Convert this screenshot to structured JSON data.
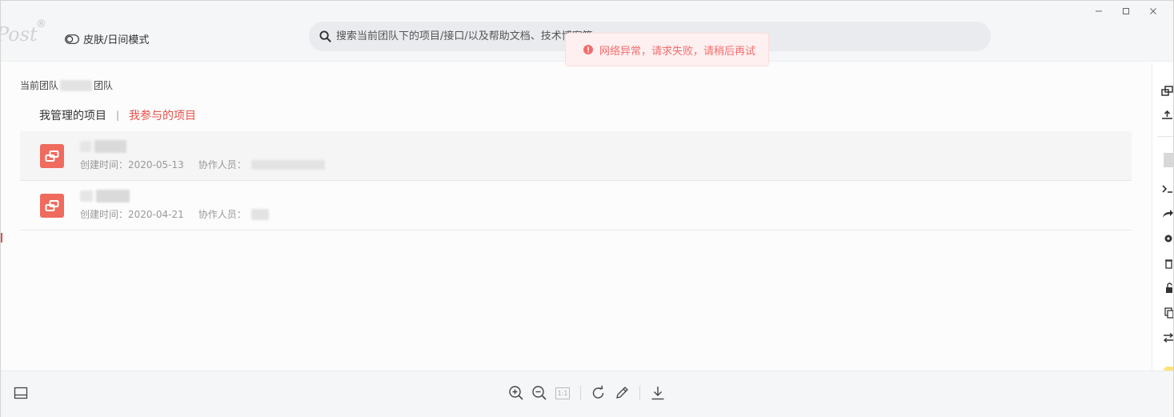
{
  "window": {
    "minimize_icon": "minimize-icon",
    "maximize_icon": "maximize-icon",
    "close_icon": "close-icon"
  },
  "header": {
    "logo_text": "Post",
    "logo_mark": "®",
    "skin_mode_label": "皮肤/日间模式",
    "search": {
      "placeholder": "搜索当前团队下的项目/接口/以及帮助文档、技术博客等",
      "value": ""
    }
  },
  "toast": {
    "message": "网络异常，请求失败，请稍后再试",
    "color": "#f56c6c"
  },
  "main": {
    "team_prefix": "当前团队",
    "team_suffix": "团队",
    "tabs": [
      {
        "label": "我管理的项目",
        "active": false
      },
      {
        "label": "我参与的项目",
        "active": true
      }
    ],
    "projects": [
      {
        "created_label": "创建时间：",
        "created_date": "2020-05-13",
        "collaborators_label": "协作人员："
      },
      {
        "created_label": "创建时间：",
        "created_date": "2020-04-21",
        "collaborators_label": "协作人员："
      }
    ]
  },
  "colors": {
    "accent": "#e8504a",
    "project_icon": "#ef6b5e",
    "header_bg": "#f5f6f7"
  },
  "footer": {
    "zoom_badge": "1:1"
  }
}
